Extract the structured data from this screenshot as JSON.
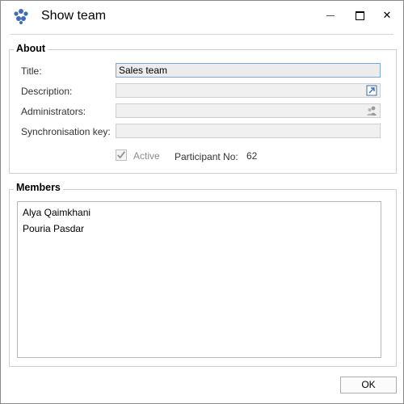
{
  "window": {
    "title": "Show team",
    "minimize_glyph": "—",
    "maximize_glyph": "■",
    "close_glyph": "✕"
  },
  "about": {
    "heading": "About",
    "title_label": "Title:",
    "title_value": "Sales team",
    "description_label": "Description:",
    "description_value": "",
    "administrators_label": "Administrators:",
    "administrators_value": "",
    "sync_key_label": "Synchronisation key:",
    "sync_key_value": "",
    "active_label": "Active",
    "active_checked": true,
    "participant_label": "Participant No:",
    "participant_value": "62"
  },
  "members": {
    "heading": "Members",
    "items": [
      "Alya Qaimkhani",
      "Pouria Pasdar"
    ]
  },
  "footer": {
    "ok_label": "OK"
  },
  "colors": {
    "icon_accent": "#3b6db3",
    "disabled_text": "#8c8c8c",
    "title_field_border": "#7aa7d4"
  },
  "icons": {
    "app": "team-icon",
    "description": "expand-icon",
    "administrators": "people-icon"
  }
}
